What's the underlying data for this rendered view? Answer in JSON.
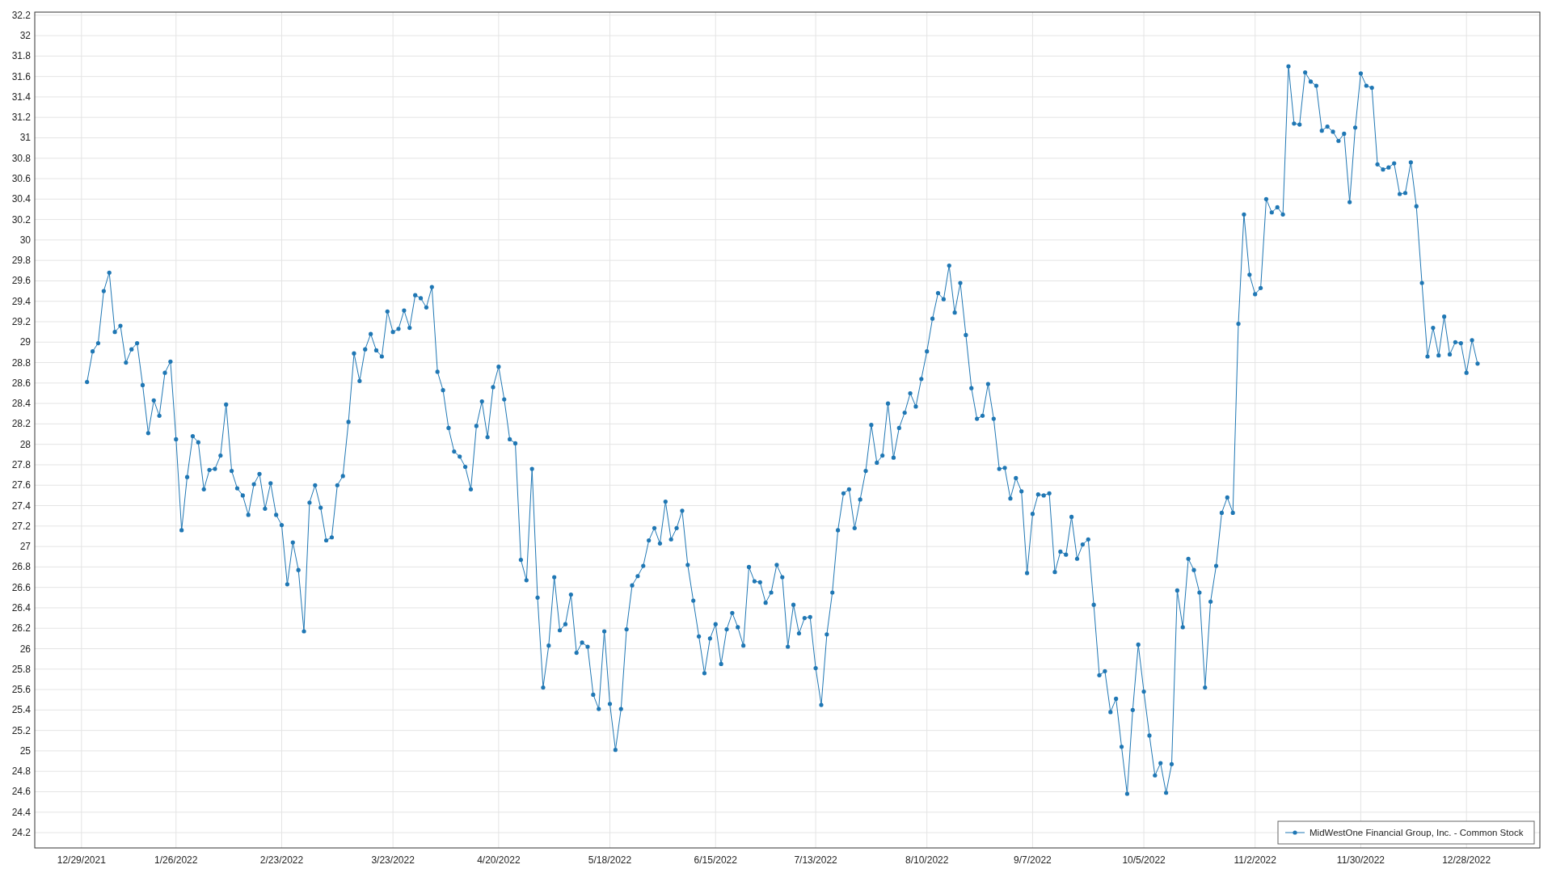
{
  "chart_data": {
    "type": "line",
    "grid": true,
    "ylim": [
      24.05,
      32.23
    ],
    "categories": [
      "12/29/2021",
      null,
      null,
      null,
      null,
      null,
      null,
      null,
      null,
      null,
      null,
      null,
      null,
      null,
      null,
      null,
      null,
      "1/26/2022",
      null,
      null,
      null,
      null,
      null,
      null,
      null,
      null,
      null,
      null,
      null,
      null,
      null,
      null,
      null,
      null,
      null,
      null,
      "2/23/2022",
      null,
      null,
      null,
      null,
      null,
      null,
      null,
      null,
      null,
      null,
      null,
      null,
      null,
      null,
      null,
      null,
      null,
      null,
      null,
      "3/23/2022",
      null,
      null,
      null,
      null,
      null,
      null,
      null,
      null,
      null,
      null,
      null,
      null,
      null,
      null,
      null,
      null,
      null,
      null,
      "4/20/2022",
      null,
      null,
      null,
      null,
      null,
      null,
      null,
      null,
      null,
      null,
      null,
      null,
      null,
      null,
      null,
      null,
      null,
      null,
      null,
      "5/18/2022",
      null,
      null,
      null,
      null,
      null,
      null,
      null,
      null,
      null,
      null,
      null,
      null,
      null,
      null,
      null,
      null,
      null,
      null,
      "6/15/2022",
      null,
      null,
      null,
      null,
      null,
      null,
      null,
      null,
      null,
      null,
      null,
      null,
      null,
      null,
      null,
      null,
      null,
      "7/13/2022",
      null,
      null,
      null,
      null,
      null,
      null,
      null,
      null,
      null,
      null,
      null,
      null,
      null,
      null,
      null,
      null,
      null,
      null,
      null,
      "8/10/2022",
      null,
      null,
      null,
      null,
      null,
      null,
      null,
      null,
      null,
      null,
      null,
      null,
      null,
      null,
      null,
      null,
      null,
      null,
      "9/7/2022",
      null,
      null,
      null,
      null,
      null,
      null,
      null,
      null,
      null,
      null,
      null,
      null,
      null,
      null,
      null,
      null,
      null,
      null,
      null,
      "10/5/2022",
      null,
      null,
      null,
      null,
      null,
      null,
      null,
      null,
      null,
      null,
      null,
      null,
      null,
      null,
      null,
      null,
      null,
      null,
      null,
      "11/2/2022",
      null,
      null,
      null,
      null,
      null,
      null,
      null,
      null,
      null,
      null,
      null,
      null,
      null,
      null,
      null,
      null,
      null,
      null,
      "11/30/2022",
      null,
      null,
      null,
      null,
      null,
      null,
      null,
      null,
      null,
      null,
      null,
      null,
      null,
      null,
      null,
      null,
      null,
      null,
      "12/28/2022",
      null,
      null
    ],
    "yticks": [
      24.2,
      24.4,
      24.6,
      24.8,
      25,
      25.2,
      25.4,
      25.6,
      25.8,
      26,
      26.2,
      26.4,
      26.6,
      26.8,
      27,
      27.2,
      27.4,
      27.6,
      27.8,
      28,
      28.2,
      28.4,
      28.6,
      28.8,
      29,
      29.2,
      29.4,
      29.6,
      29.8,
      30,
      30.2,
      30.4,
      30.6,
      30.8,
      31,
      31.2,
      31.4,
      31.6,
      31.8,
      32,
      32.2
    ],
    "series": [
      {
        "name": "MidWestOne Financial Group, Inc. - Common Stock",
        "color": "#1f77b4",
        "values": [
          null,
          28.61,
          28.91,
          28.99,
          29.5,
          29.68,
          29.1,
          29.16,
          28.8,
          28.93,
          28.99,
          28.58,
          28.11,
          28.43,
          28.28,
          28.7,
          28.81,
          28.05,
          27.16,
          27.68,
          28.08,
          28.02,
          27.56,
          27.75,
          27.76,
          27.89,
          28.39,
          27.74,
          27.57,
          27.5,
          27.31,
          27.61,
          27.71,
          27.37,
          27.62,
          27.31,
          27.21,
          26.63,
          27.04,
          26.77,
          26.17,
          27.43,
          27.6,
          27.38,
          27.06,
          27.09,
          27.6,
          27.69,
          28.22,
          28.89,
          28.62,
          28.93,
          29.08,
          28.92,
          28.86,
          29.3,
          29.1,
          29.13,
          29.31,
          29.14,
          29.46,
          29.43,
          29.34,
          29.54,
          28.71,
          28.53,
          28.16,
          27.93,
          27.88,
          27.78,
          27.56,
          28.18,
          28.42,
          28.07,
          28.56,
          28.76,
          28.44,
          28.05,
          28.01,
          26.87,
          26.67,
          27.76,
          26.5,
          25.62,
          26.03,
          26.7,
          26.18,
          26.24,
          26.53,
          25.96,
          26.06,
          26.02,
          25.55,
          25.41,
          26.17,
          25.46,
          25.01,
          25.41,
          26.19,
          26.62,
          26.71,
          26.81,
          27.06,
          27.18,
          27.03,
          27.44,
          27.07,
          27.18,
          27.35,
          26.82,
          26.47,
          26.12,
          25.76,
          26.1,
          26.24,
          25.85,
          26.19,
          26.35,
          26.21,
          26.03,
          26.8,
          26.66,
          26.65,
          26.45,
          26.55,
          26.82,
          26.7,
          26.02,
          26.43,
          26.15,
          26.3,
          26.31,
          25.81,
          25.45,
          26.14,
          26.55,
          27.16,
          27.52,
          27.56,
          27.18,
          27.46,
          27.74,
          28.19,
          27.82,
          27.89,
          28.4,
          27.87,
          28.16,
          28.31,
          28.5,
          28.37,
          28.64,
          28.91,
          29.23,
          29.48,
          29.42,
          29.75,
          29.29,
          29.58,
          29.07,
          28.55,
          28.25,
          28.28,
          28.59,
          28.25,
          27.76,
          27.77,
          27.47,
          27.67,
          27.54,
          26.74,
          27.32,
          27.51,
          27.5,
          27.52,
          26.75,
          26.95,
          26.92,
          27.29,
          26.88,
          27.02,
          27.07,
          26.43,
          25.74,
          25.78,
          25.38,
          25.51,
          25.04,
          24.58,
          25.4,
          26.04,
          25.58,
          25.15,
          24.76,
          24.88,
          24.59,
          24.87,
          26.57,
          26.21,
          26.88,
          26.77,
          26.55,
          25.62,
          26.46,
          26.81,
          27.33,
          27.48,
          27.33,
          29.18,
          30.25,
          29.66,
          29.47,
          29.53,
          30.4,
          30.27,
          30.32,
          30.25,
          31.7,
          31.14,
          31.13,
          31.64,
          31.55,
          31.51,
          31.07,
          31.11,
          31.06,
          30.97,
          31.04,
          30.37,
          31.1,
          31.63,
          31.51,
          31.49,
          30.74,
          30.69,
          30.71,
          30.75,
          30.45,
          30.46,
          30.76,
          30.33,
          29.58,
          28.86,
          29.14,
          28.87,
          29.25,
          28.88,
          29.0,
          28.99,
          28.7,
          29.02,
          28.79
        ]
      }
    ]
  }
}
